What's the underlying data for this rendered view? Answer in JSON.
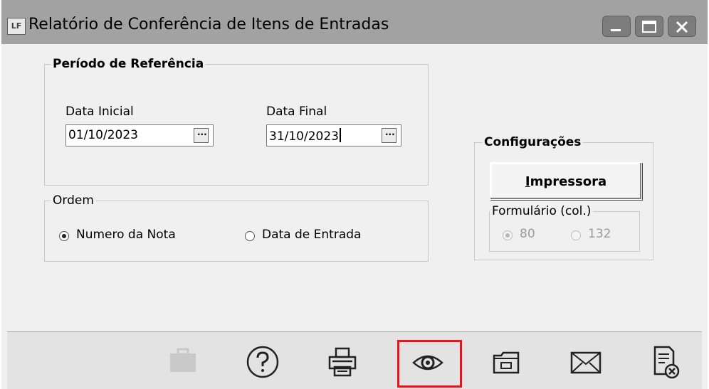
{
  "window": {
    "app_icon_text": "LF",
    "title": "Relatório de Conferência de Itens de Entradas"
  },
  "periodo": {
    "legend": "Período de Referência",
    "data_inicial_label": "Data Inicial",
    "data_inicial_value": "01/10/2023",
    "data_final_label": "Data Final",
    "data_final_value": "31/10/2023",
    "picker_glyph": "···"
  },
  "ordem": {
    "legend": "Ordem",
    "options": [
      {
        "label": "Numero da Nota",
        "checked": true
      },
      {
        "label": "Data de Entrada",
        "checked": false
      }
    ]
  },
  "configuracoes": {
    "legend": "Configurações",
    "impressora_button": {
      "underline": "I",
      "rest": "mpressora"
    },
    "formulario": {
      "legend": "Formulário (col.)",
      "options": [
        {
          "label": "80",
          "checked": true
        },
        {
          "label": "132",
          "checked": false
        }
      ]
    }
  },
  "toolbar": {
    "buttons": [
      "briefcase-icon",
      "help-icon",
      "print-icon",
      "preview-eye-icon",
      "folder-icon",
      "email-icon",
      "close-report-icon"
    ],
    "highlighted": "preview-eye-icon",
    "highlight_color": "#e8141a"
  }
}
